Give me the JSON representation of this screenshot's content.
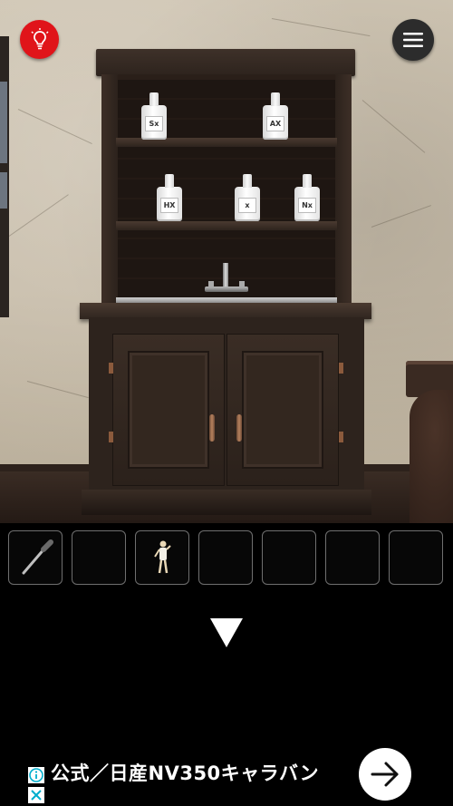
{
  "scene": {
    "bottles_top": [
      {
        "label": "Sx"
      },
      {
        "label": "AX"
      }
    ],
    "bottles_mid": [
      {
        "label": "HX"
      },
      {
        "label": "x"
      },
      {
        "label": "Nx"
      }
    ]
  },
  "controls": {
    "hint_icon": "lightbulb-icon",
    "menu_icon": "hamburger-menu-icon",
    "nav_icon": "arrow-down-icon",
    "hint_color": "#e0141a"
  },
  "inventory": {
    "slots": [
      {
        "item": "dropper"
      },
      {
        "item": ""
      },
      {
        "item": "doll-figure"
      },
      {
        "item": ""
      },
      {
        "item": ""
      },
      {
        "item": ""
      },
      {
        "item": ""
      }
    ]
  },
  "ad": {
    "text": "公式／日産NV350キャラバン",
    "arrow_icon": "arrow-right-icon"
  }
}
